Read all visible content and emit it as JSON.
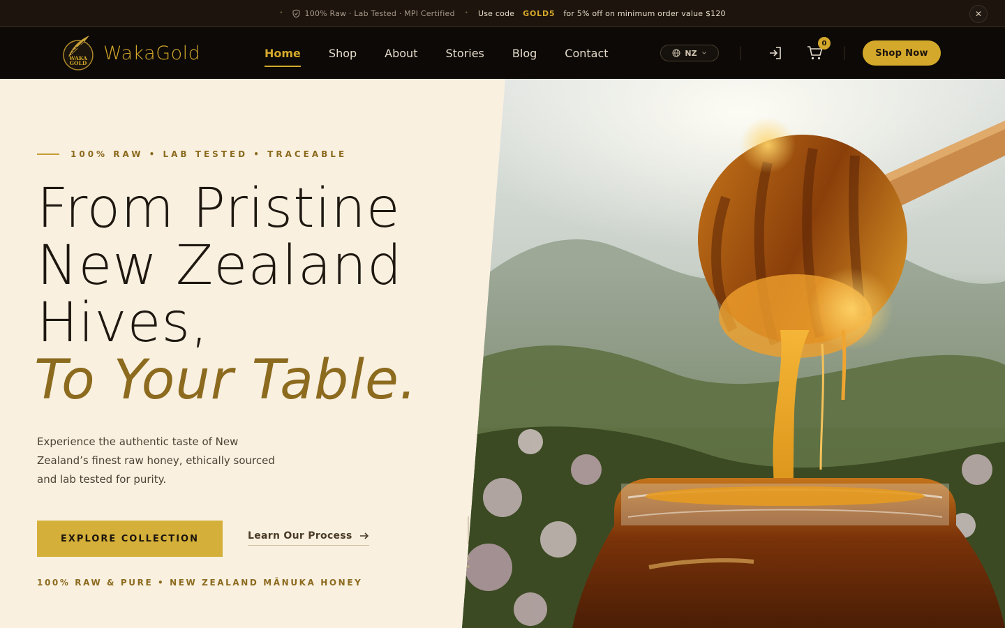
{
  "announcement": {
    "badge_text": "100% Raw · Lab Tested · MPI Certified",
    "promo_prefix": "Use code",
    "promo_code": "GOLD5",
    "promo_suffix": "for 5% off on minimum order value $120",
    "close_icon": "close-icon"
  },
  "nav": {
    "brand": "WakaGold",
    "logo_line1": "WAKA",
    "logo_line2": "GOLD",
    "links": [
      "Home",
      "Shop",
      "About",
      "Stories",
      "Blog",
      "Contact"
    ],
    "active": "Home",
    "region": "NZ",
    "cart_count": "0",
    "shop_now": "Shop Now"
  },
  "hero": {
    "eyebrow": "100% RAW • LAB TESTED • TRACEABLE",
    "headline_lines": [
      "From Pristine",
      "New Zealand",
      "Hives,"
    ],
    "headline_accent": "To Your Table.",
    "subtext": "Experience the authentic taste of New Zealand’s finest raw honey, ethically sourced and lab tested for purity.",
    "cta_primary": "EXPLORE COLLECTION",
    "cta_secondary": "Learn Our Process",
    "tagline": "100% RAW & PURE • NEW ZEALAND MĀNUKA HONEY"
  },
  "colors": {
    "gold": "#d4a82b",
    "dark": "#0c0906",
    "cream": "#f9f0e0",
    "accent_brown": "#8c6a1e"
  }
}
